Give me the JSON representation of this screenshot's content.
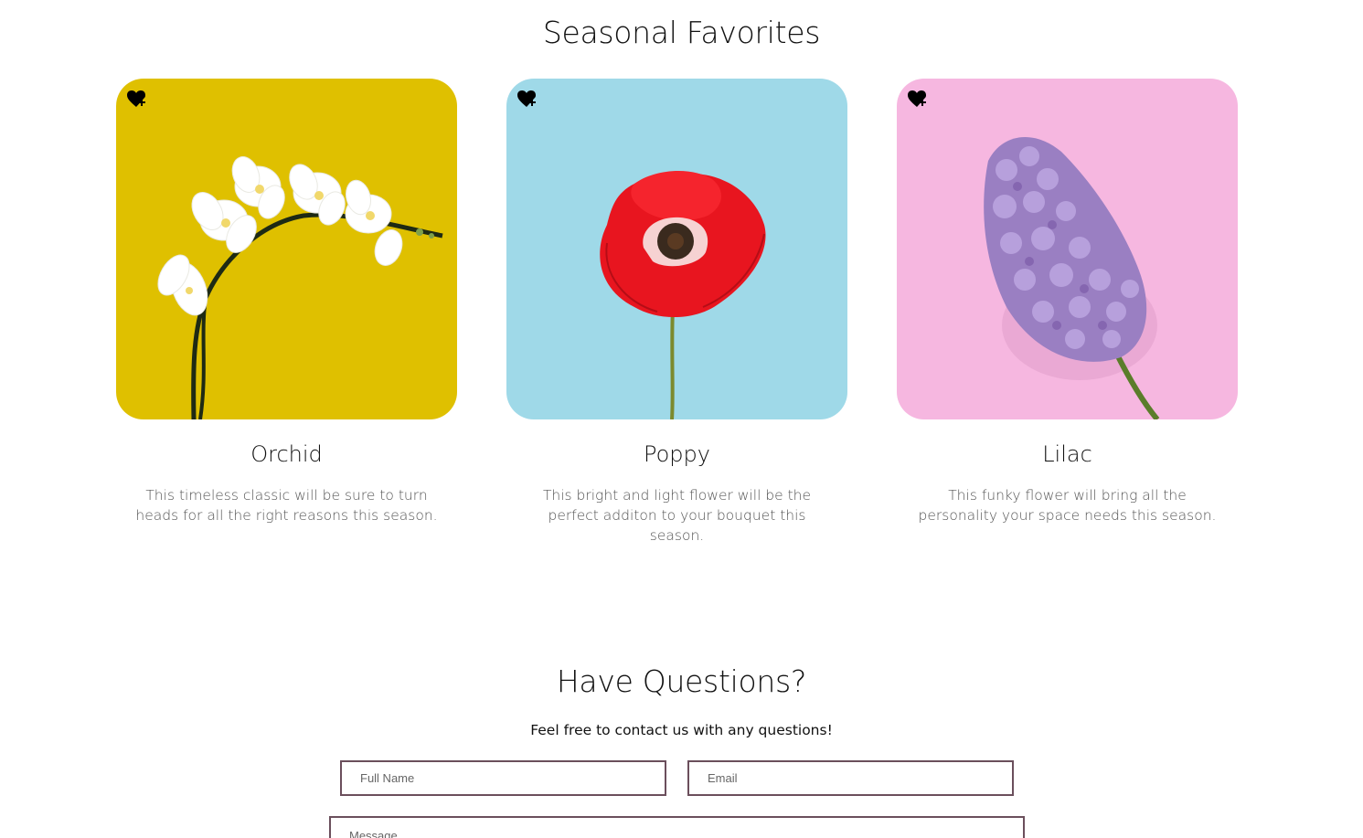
{
  "seasonal": {
    "title": "Seasonal Favorites",
    "cards": [
      {
        "name": "Orchid",
        "description": "This timeless classic will be sure to turn heads for all the right reasons this season.",
        "background": "#dfc000",
        "favorite_icon": "heart-plus-icon"
      },
      {
        "name": "Poppy",
        "description": "This bright and light flower will be the perfect additon to your bouquet this season.",
        "background": "#9fd9e8",
        "favorite_icon": "heart-plus-icon"
      },
      {
        "name": "Lilac",
        "description": "This funky flower will bring all the personality your space needs this season.",
        "background": "#f6b7e0",
        "favorite_icon": "heart-plus-icon"
      }
    ]
  },
  "contact": {
    "title": "Have Questions?",
    "subtitle": "Feel free to contact us with any questions!",
    "fullname_placeholder": "Full Name",
    "email_placeholder": "Email",
    "message_placeholder": "Message",
    "border_color": "#6b4f5c"
  }
}
